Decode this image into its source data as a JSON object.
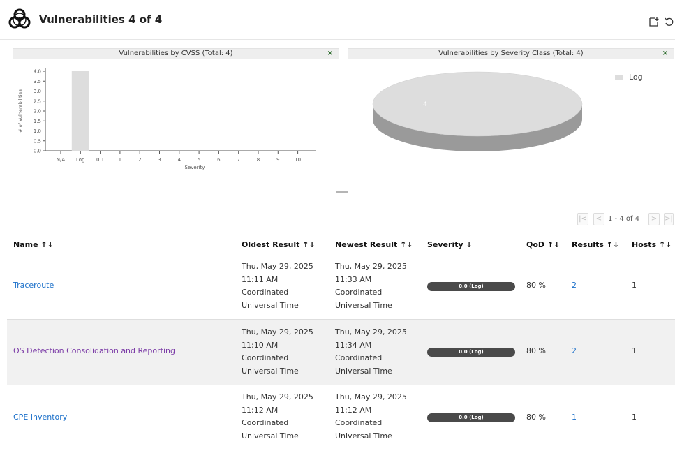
{
  "header": {
    "title": "Vulnerabilities 4 of 4"
  },
  "icons": {
    "logo": "biohazard-icon",
    "new_dashboard": "new-dashboard-icon",
    "reset": "reset-icon"
  },
  "charts": {
    "cvss": {
      "title": "Vulnerabilities by CVSS (Total: 4)",
      "close": "×"
    },
    "severity": {
      "title": "Vulnerabilities by Severity Class (Total: 4)",
      "close": "×"
    }
  },
  "chart_data": [
    {
      "type": "bar",
      "title": "Vulnerabilities by CVSS (Total: 4)",
      "xlabel": "Severity",
      "ylabel": "# of Vulnerabilities",
      "categories": [
        "N/A",
        "Log",
        "0.1",
        "1",
        "2",
        "3",
        "4",
        "5",
        "6",
        "7",
        "8",
        "9",
        "10"
      ],
      "values": [
        0,
        4,
        0,
        0,
        0,
        0,
        0,
        0,
        0,
        0,
        0,
        0,
        0
      ],
      "ylim": [
        0,
        4
      ],
      "yticks": [
        "0.0",
        "0.5",
        "1.0",
        "1.5",
        "2.0",
        "2.5",
        "3.0",
        "3.5",
        "4.0"
      ],
      "color": "#dddddd"
    },
    {
      "type": "pie",
      "title": "Vulnerabilities by Severity Class (Total: 4)",
      "labels": [
        "Log"
      ],
      "values": [
        4
      ],
      "slice_label": "4",
      "legend": "top-right",
      "color": "#dddddd"
    }
  ],
  "pagination": {
    "text": "1 - 4 of 4"
  },
  "table": {
    "columns": [
      "Name ↑↓",
      "Oldest Result ↑↓",
      "Newest Result ↑↓",
      "Severity ↓",
      "QoD ↑↓",
      "Results ↑↓",
      "Hosts ↑↓"
    ],
    "rows": [
      {
        "name": "Traceroute",
        "oldest": [
          "Thu, May 29, 2025",
          "11:11 AM",
          "Coordinated",
          "Universal Time"
        ],
        "newest": [
          "Thu, May 29, 2025",
          "11:33 AM",
          "Coordinated",
          "Universal Time"
        ],
        "severity": "0.0 (Log)",
        "qod": "80 %",
        "results": "2",
        "hosts": "1"
      },
      {
        "name": "OS Detection Consolidation and Reporting",
        "oldest": [
          "Thu, May 29, 2025",
          "11:10 AM",
          "Coordinated",
          "Universal Time"
        ],
        "newest": [
          "Thu, May 29, 2025",
          "11:34 AM",
          "Coordinated",
          "Universal Time"
        ],
        "severity": "0.0 (Log)",
        "qod": "80 %",
        "results": "2",
        "hosts": "1"
      },
      {
        "name": "CPE Inventory",
        "oldest": [
          "Thu, May 29, 2025",
          "11:12 AM",
          "Coordinated",
          "Universal Time"
        ],
        "newest": [
          "Thu, May 29, 2025",
          "11:12 AM",
          "Coordinated",
          "Universal Time"
        ],
        "severity": "0.0 (Log)",
        "qod": "80 %",
        "results": "1",
        "hosts": "1"
      }
    ]
  }
}
